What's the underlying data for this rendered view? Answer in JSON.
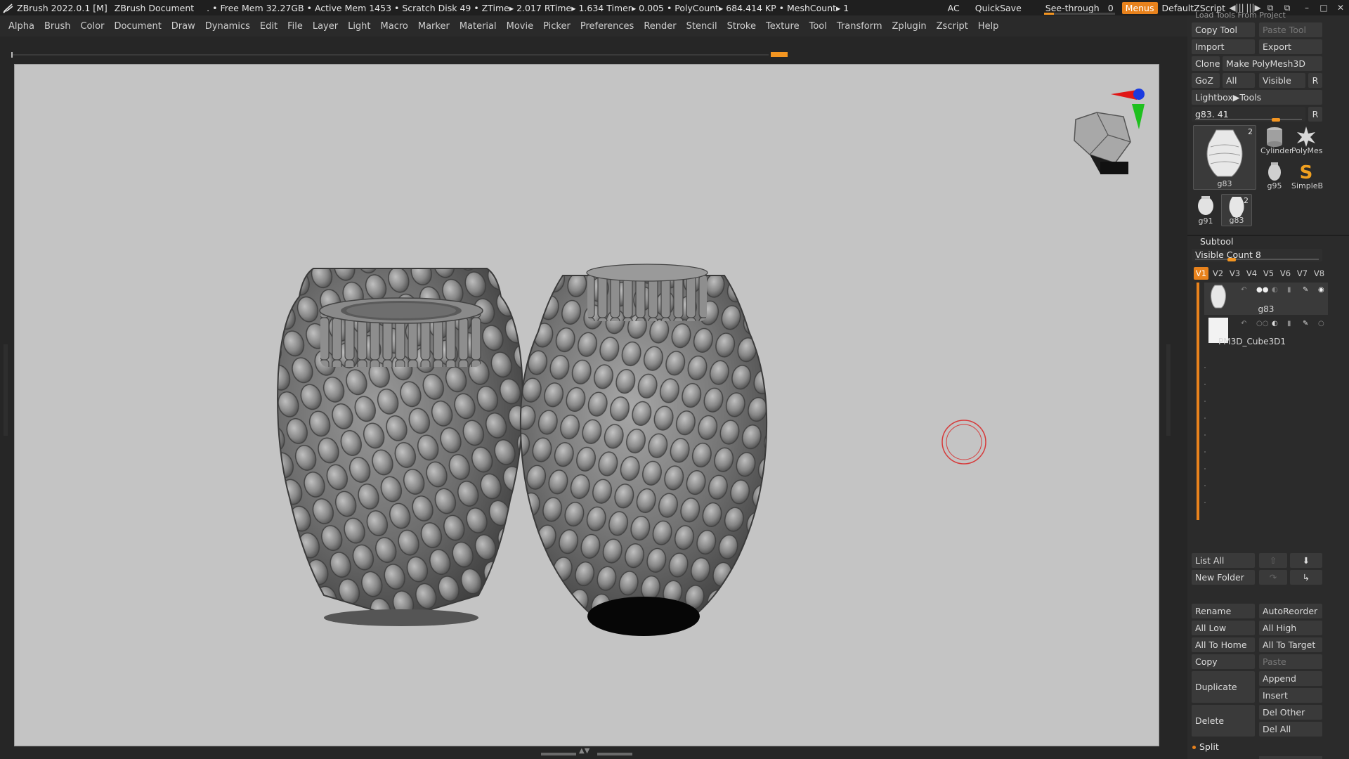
{
  "titlebar": {
    "app_version": "ZBrush 2022.0.1 [M]",
    "document": "ZBrush Document",
    "stats": ". • Free Mem 32.27GB • Active Mem 1453 • Scratch Disk 49 •  ZTime▸ 2.017 RTime▸ 1.634 Timer▸ 0.005 • PolyCount▸ 684.414 KP  • MeshCount▸ 1",
    "ac": "AC",
    "quicksave": "QuickSave",
    "see_through_label": "See-through",
    "see_through_value": "0",
    "menus": "Menus",
    "script": "DefaultZScript",
    "win_controls": [
      "◄|||",
      "|||►",
      "⧉",
      "⧉",
      "–",
      "□",
      "✕"
    ]
  },
  "menubar": {
    "items": [
      "Alpha",
      "Brush",
      "Color",
      "Document",
      "Draw",
      "Dynamics",
      "Edit",
      "File",
      "Layer",
      "Light",
      "Macro",
      "Marker",
      "Material",
      "Movie",
      "Picker",
      "Preferences",
      "Render",
      "Stencil",
      "Stroke",
      "Texture",
      "Tool",
      "Transform",
      "Zplugin",
      "Zscript",
      "Help"
    ]
  },
  "tool_panel": {
    "top_partial": "Load Tools From Project",
    "copy_tool": "Copy Tool",
    "paste_tool": "Paste Tool",
    "import": "Import",
    "export": "Export",
    "clone": "Clone",
    "make_polymesh": "Make PolyMesh3D",
    "goz": "GoZ",
    "all": "All",
    "visible": "Visible",
    "r": "R",
    "lightbox_tools": "Lightbox▶Tools",
    "current_tool_slider": "g83. 41",
    "current_tool_slider_value": 0.78,
    "thumbnails": [
      {
        "label": "g83",
        "count": "2"
      },
      {
        "label": "Cylinder",
        "count": ""
      },
      {
        "label": "PolyMes",
        "count": ""
      },
      {
        "label": "g95",
        "count": ""
      },
      {
        "label": "SimpleB",
        "count": ""
      },
      {
        "label": "g91",
        "count": ""
      },
      {
        "label": "g83",
        "count": "2"
      }
    ]
  },
  "subtool": {
    "title": "Subtool",
    "visible_count": "Visible Count 8",
    "visible_count_value": 0.28,
    "version_tabs": [
      "V1",
      "V2",
      "V3",
      "V4",
      "V5",
      "V6",
      "V7",
      "V8"
    ],
    "active_tab": "V1",
    "items": [
      {
        "name": "g83",
        "selected": true
      },
      {
        "name": "PM3D_Cube3D1",
        "selected": false
      }
    ],
    "buttons": {
      "list_all": "List All",
      "new_folder": "New Folder",
      "rename": "Rename",
      "auto_reorder": "AutoReorder",
      "all_low": "All Low",
      "all_high": "All High",
      "all_to_home": "All To Home",
      "all_to_target": "All To Target",
      "copy": "Copy",
      "paste": "Paste",
      "duplicate": "Duplicate",
      "append": "Append",
      "insert": "Insert",
      "delete": "Delete",
      "del_other": "Del Other",
      "del_all": "Del All",
      "split": "Split"
    }
  },
  "colors": {
    "accent": "#e8821c",
    "canvas_bg": "#c4c4c4",
    "panel_bg": "#2b2b2b",
    "button_bg": "#3a3a3a",
    "brush_cursor": "#d63a3a"
  }
}
